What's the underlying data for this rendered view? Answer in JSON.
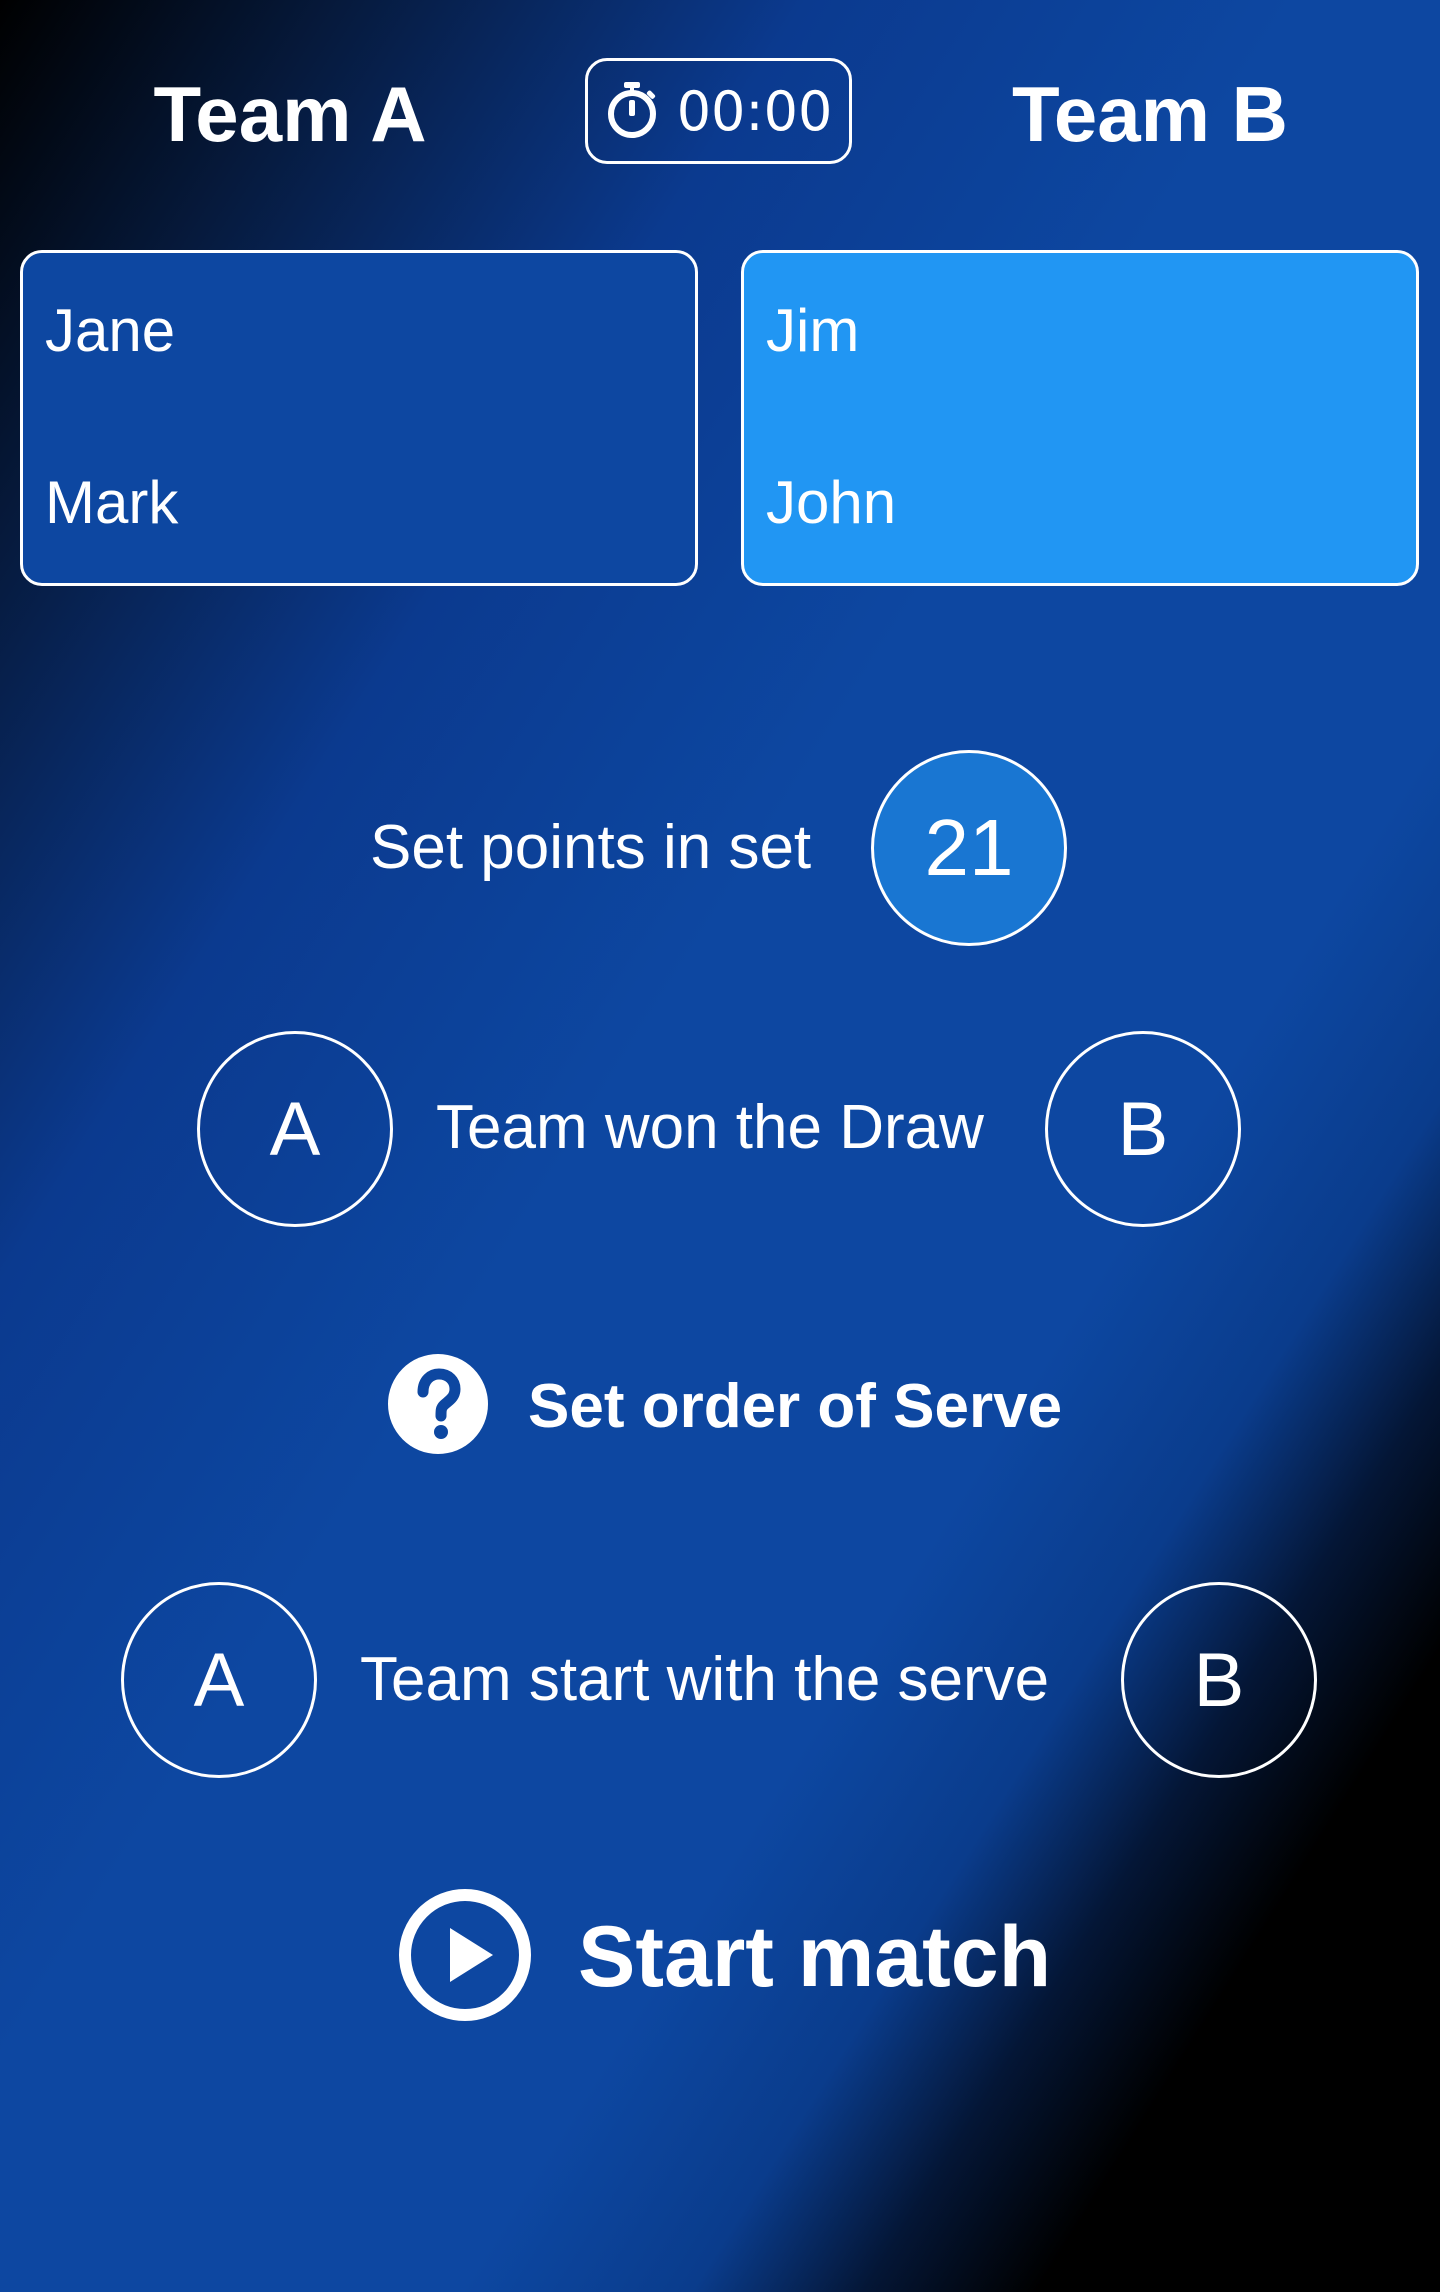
{
  "header": {
    "team_a_title": "Team A",
    "team_b_title": "Team B",
    "timer": "00:00"
  },
  "team_a": {
    "players": [
      "Jane",
      "Mark"
    ],
    "card_color": "#0d47a1"
  },
  "team_b": {
    "players": [
      "Jim",
      "John"
    ],
    "card_color": "#2196f3"
  },
  "set_points": {
    "label": "Set points in set",
    "value": "21",
    "badge_color": "#1976d2"
  },
  "draw": {
    "label": "Team won the Draw",
    "option_a": "A",
    "option_b": "B"
  },
  "order_of_serve": {
    "label": "Set order of Serve",
    "icon": "help-circle-icon"
  },
  "serve": {
    "label": "Team start with the serve",
    "option_a": "A",
    "option_b": "B"
  },
  "start": {
    "label": "Start match",
    "icon": "play-circle-icon"
  }
}
